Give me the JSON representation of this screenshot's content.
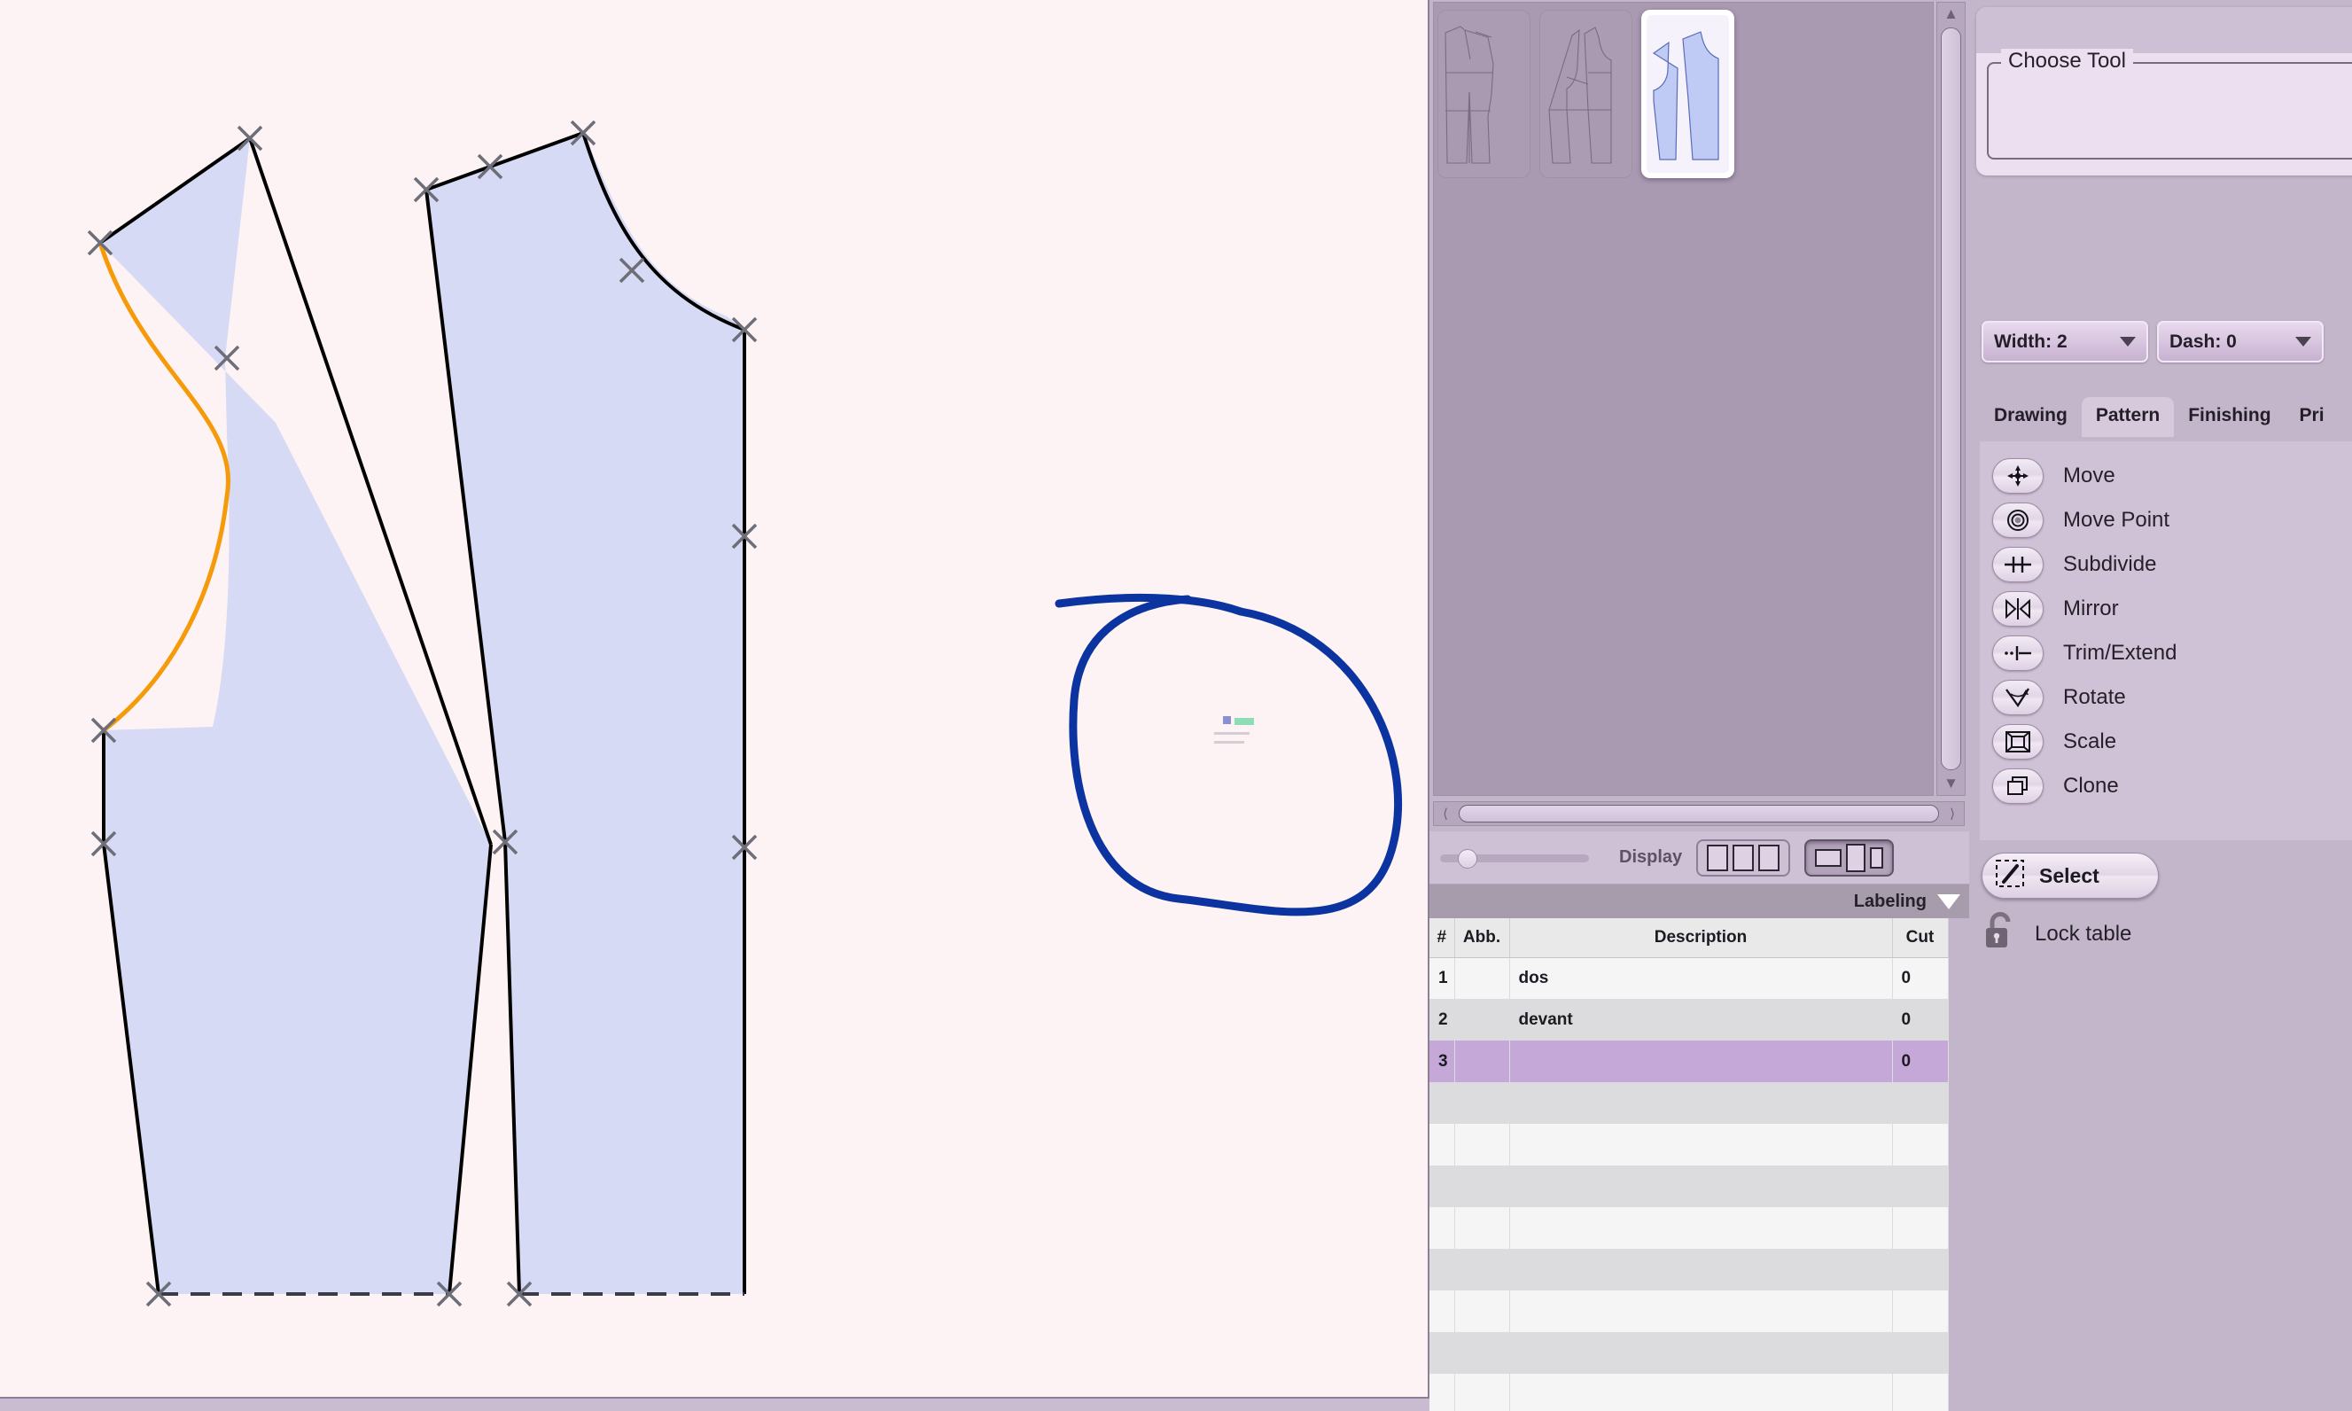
{
  "canvas": {
    "background_color": "#fdf2f4",
    "piece_fill": "#d6daf5",
    "piece_stroke": "#000000",
    "highlight_curve_color": "#f59b0a",
    "sketch_color": "#0b34a0",
    "marker_color": "#6e6e78",
    "pieces": [
      {
        "name": "back-piece",
        "has_orange_curve": true
      },
      {
        "name": "front-piece",
        "has_orange_curve": false
      }
    ],
    "sketch_annotation": "hand-drawn-closed-loop"
  },
  "thumbnails": {
    "items": [
      {
        "name": "thumbnail-1",
        "selected": false
      },
      {
        "name": "thumbnail-2",
        "selected": false
      },
      {
        "name": "thumbnail-3",
        "selected": true
      }
    ]
  },
  "display_bar": {
    "label": "Display",
    "zoom_value": 12,
    "buttons": [
      {
        "name": "display-mode-three-equal",
        "active": false
      },
      {
        "name": "display-mode-mixed",
        "active": true
      }
    ]
  },
  "labeling": {
    "title": "Labeling",
    "columns": [
      "#",
      "Abb.",
      "Description",
      "Cut"
    ],
    "rows": [
      {
        "num": "1",
        "abb": "",
        "description": "dos",
        "cut": "0",
        "selected": false
      },
      {
        "num": "2",
        "abb": "",
        "description": "devant",
        "cut": "0",
        "selected": false
      },
      {
        "num": "3",
        "abb": "",
        "description": "",
        "cut": "0",
        "selected": true
      }
    ],
    "empty_row_count": 8
  },
  "right_panel": {
    "choose_tool_legend": "Choose Tool",
    "dropdowns": [
      {
        "name": "width-dropdown",
        "label": "Width: 2"
      },
      {
        "name": "dash-dropdown",
        "label": "Dash: 0"
      }
    ],
    "tabs": [
      {
        "label": "Drawing",
        "active": false
      },
      {
        "label": "Pattern",
        "active": true
      },
      {
        "label": "Finishing",
        "active": false
      },
      {
        "label": "Pri",
        "active": false
      }
    ],
    "tools": [
      {
        "label": "Move",
        "icon": "move-arrows-icon"
      },
      {
        "label": "Move Point",
        "icon": "concentric-circles-icon"
      },
      {
        "label": "Subdivide",
        "icon": "subdivide-icon"
      },
      {
        "label": "Mirror",
        "icon": "mirror-triangles-icon"
      },
      {
        "label": "Trim/Extend",
        "icon": "trim-extend-icon"
      },
      {
        "label": "Rotate",
        "icon": "rotate-angle-icon"
      },
      {
        "label": "Scale",
        "icon": "scale-nested-square-icon"
      },
      {
        "label": "Clone",
        "icon": "clone-stacked-squares-icon"
      }
    ],
    "select_button": {
      "label": "Select",
      "icon": "marquee-select-icon"
    },
    "lock_table": {
      "label": "Lock table",
      "icon": "open-padlock-icon",
      "locked": false
    }
  }
}
